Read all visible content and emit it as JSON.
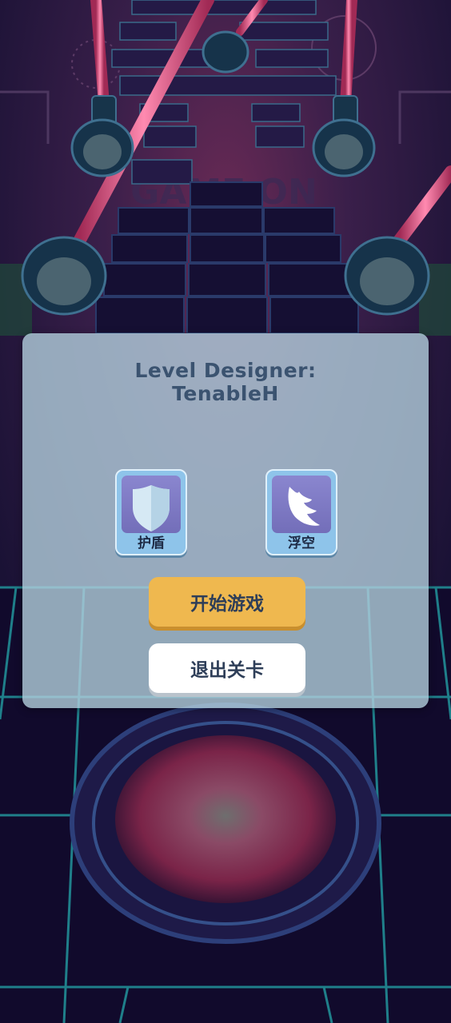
{
  "level_panel": {
    "designer_line1": "Level Designer:",
    "designer_line2": "TenableH"
  },
  "powerups": [
    {
      "label": "护盾",
      "icon": "shield-icon"
    },
    {
      "label": "浮空",
      "icon": "wing-icon"
    }
  ],
  "buttons": {
    "start_label": "开始游戏",
    "quit_label": "退出关卡"
  },
  "colors": {
    "start_button": "#efb84f",
    "quit_button": "#ffffff",
    "panel": "#b2cedc",
    "powerup_face": "#7d78c4",
    "laser": "#e0457a"
  }
}
